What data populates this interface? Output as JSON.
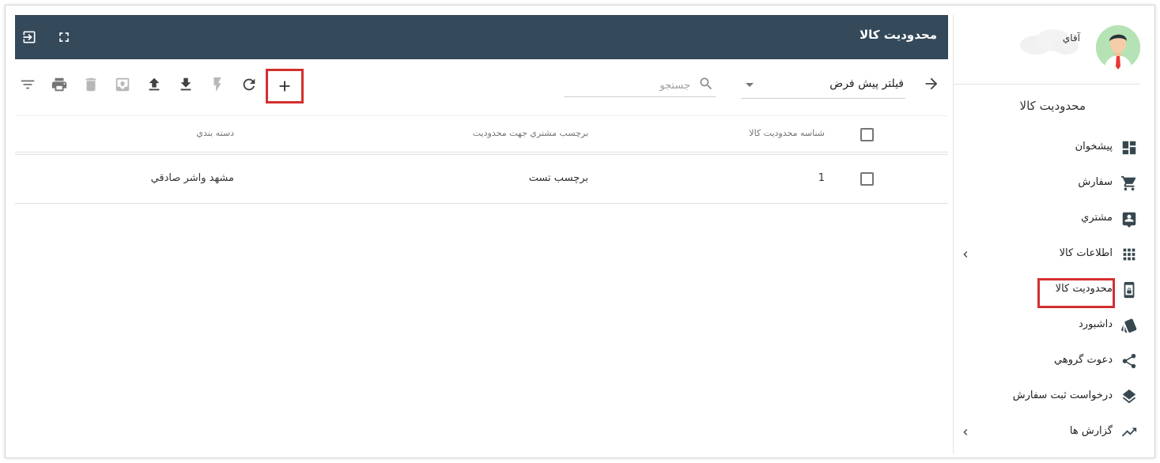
{
  "header": {
    "title": "محدوديت کالا",
    "exit_icon": "exit-to-app-icon",
    "fullscreen_icon": "fullscreen-icon"
  },
  "toolbar": {
    "filter_select_value": "فيلتر پيش فرض",
    "search_placeholder": "جستجو",
    "buttons": [
      "filter-list-icon",
      "print-icon",
      "delete-icon",
      "archive-icon",
      "upload-icon",
      "download-icon",
      "flash-icon",
      "refresh-icon",
      "add-icon"
    ],
    "highlight_color": "#d32f2f"
  },
  "table": {
    "columns": [
      "شناسه محدوديت کالا",
      "برچسب مشتري جهت محدوديت",
      "دسته بندي"
    ],
    "rows": [
      {
        "id": "1",
        "label": "برچسب تست",
        "category": "مشهد واشر صادقي"
      }
    ]
  },
  "sidebar": {
    "user_name": "آقاي",
    "section_title": "محدوديت کالا",
    "items": [
      {
        "label": "پيشخوان",
        "icon": "dashboard-icon"
      },
      {
        "label": "سفارش",
        "icon": "cart-icon"
      },
      {
        "label": "مشتري",
        "icon": "contact-icon"
      },
      {
        "label": "اطلاعات کالا",
        "icon": "apps-grid-icon"
      },
      {
        "label": "محدوديت کالا",
        "icon": "lock-phone-icon"
      },
      {
        "label": "داشبورد",
        "icon": "cards-icon"
      },
      {
        "label": "دعوت گروهي",
        "icon": "share-icon"
      },
      {
        "label": "درخواست ثبت سفارش",
        "icon": "layers-icon"
      },
      {
        "label": "گزارش ها",
        "icon": "trending-up-icon"
      }
    ]
  },
  "colors": {
    "header_bg": "#34495a",
    "accent_red": "#d32f2f"
  }
}
